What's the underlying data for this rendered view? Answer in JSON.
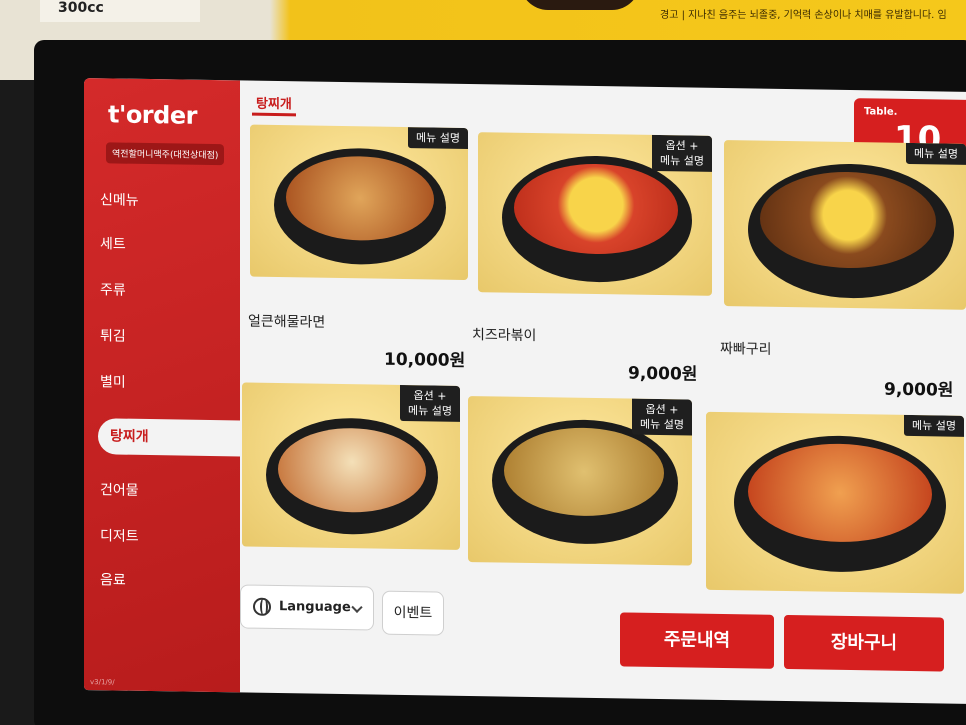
{
  "poster": {
    "tag_text": "300cc",
    "warning_text": "경고 | 지나친 음주는 뇌졸중, 기억력 손상이나 치매를 유발합니다. 임"
  },
  "sidebar": {
    "brand": "t'order",
    "store_name": "역전할머니맥주(대전상대점)",
    "items": [
      {
        "label": "신메뉴"
      },
      {
        "label": "세트"
      },
      {
        "label": "주류"
      },
      {
        "label": "튀김"
      },
      {
        "label": "별미"
      },
      {
        "label": "탕찌개",
        "active": true
      },
      {
        "label": "건어물"
      },
      {
        "label": "디저트"
      },
      {
        "label": "음료"
      }
    ],
    "version": "v3/1/9/"
  },
  "category_title": "탕찌개",
  "table": {
    "label": "Table.",
    "number": "10"
  },
  "menu": [
    {
      "name": "얼큰해물라면",
      "price": "10,000원",
      "tag": "메뉴 설명",
      "icon": "seafood-ramen-image"
    },
    {
      "name": "치즈라볶이",
      "price": "9,000원",
      "tag": "옵션 +\n메뉴 설명",
      "icon": "cheese-rabokki-image"
    },
    {
      "name": "짜빠구리",
      "price": "9,000원",
      "tag": "메뉴 설명",
      "icon": "jjapaguri-image"
    },
    {
      "name": "",
      "price": "",
      "tag": "옵션 +\n메뉴 설명",
      "icon": "cutlet-udon-image"
    },
    {
      "name": "",
      "price": "",
      "tag": "옵션 +\n메뉴 설명",
      "icon": "doenjang-stew-image"
    },
    {
      "name": "",
      "price": "",
      "tag": "메뉴 설명",
      "icon": "kimchi-stew-image"
    }
  ],
  "controls": {
    "language_label": "Language",
    "event_label": "이벤트",
    "order_history_label": "주문내역",
    "cart_label": "장바구니"
  },
  "colors": {
    "accent": "#d61f1f",
    "sidebar": "#c62222"
  }
}
